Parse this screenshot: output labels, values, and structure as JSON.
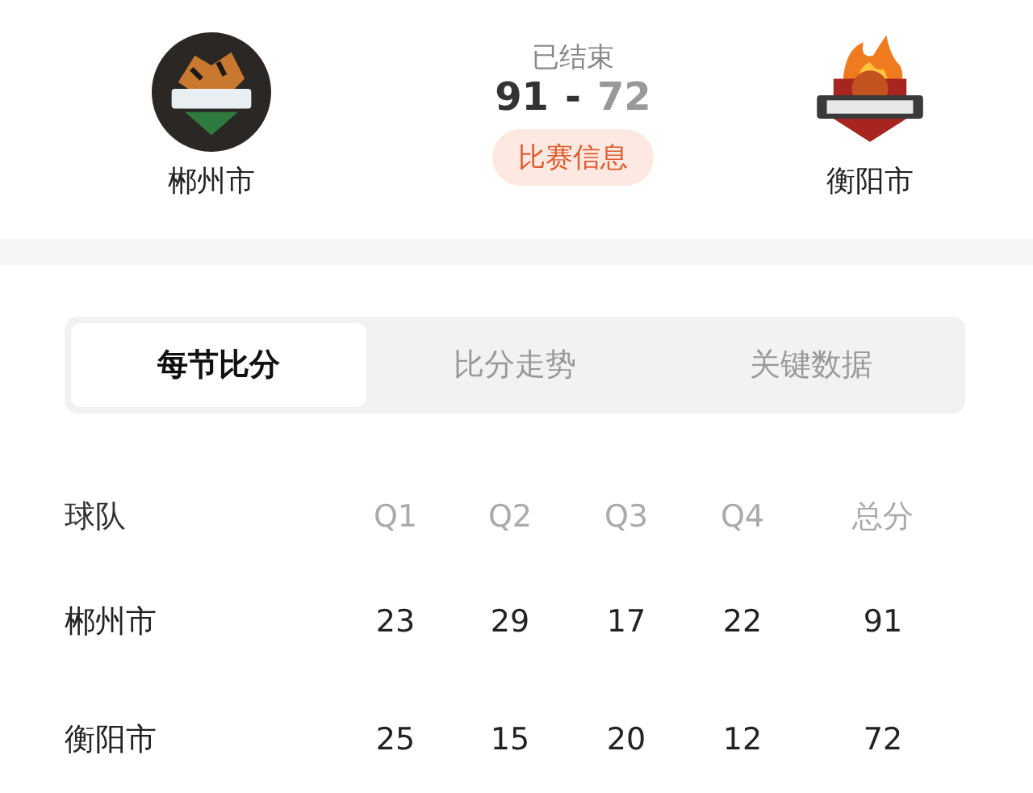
{
  "match": {
    "status": "已结束",
    "home": {
      "name": "郴州市",
      "score": "91",
      "leading": true,
      "kind": "tiger"
    },
    "away": {
      "name": "衡阳市",
      "score": "72",
      "leading": false,
      "kind": "flame"
    },
    "separator": "-",
    "info_button": "比赛信息"
  },
  "tabs": [
    {
      "label": "每节比分",
      "selected": true
    },
    {
      "label": "比分走势",
      "selected": false
    },
    {
      "label": "关键数据",
      "selected": false
    }
  ],
  "table": {
    "columns": [
      "球队",
      "Q1",
      "Q2",
      "Q3",
      "Q4",
      "总分"
    ],
    "rows": [
      [
        "郴州市",
        "23",
        "29",
        "17",
        "22",
        "91"
      ],
      [
        "衡阳市",
        "25",
        "15",
        "20",
        "12",
        "72"
      ]
    ]
  }
}
